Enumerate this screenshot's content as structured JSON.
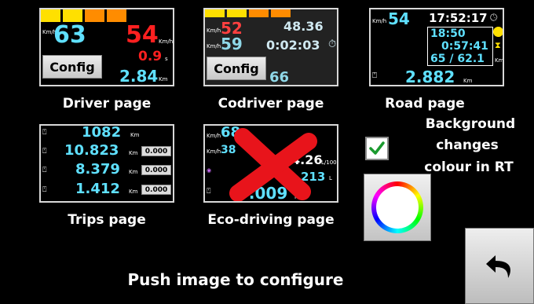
{
  "driver": {
    "caption": "Driver page",
    "speed": "63",
    "speed_unit": "Km/h",
    "limit": "54",
    "limit_unit": "Km/h",
    "small_red": "0.9",
    "small_red_unit": "s",
    "distance": "2.84",
    "distance_unit": "Km",
    "config_label": "Config"
  },
  "codriver": {
    "caption": "Codriver page",
    "speed_red": "52",
    "speed_cyan": "59",
    "dist": "48.36",
    "time": "0:02:03",
    "bottom_partial": "66",
    "unit_kmh": "Km/h",
    "config_label": "Config"
  },
  "road": {
    "caption": "Road page",
    "speed": "54",
    "speed_unit": "Km/h",
    "clock": "17:52:17",
    "time2": "18:50",
    "time3": "0:57:41",
    "dist_pair": "65 / 62.1",
    "dist_pair_unit": "Km",
    "distance": "2.882",
    "distance_unit": "Km"
  },
  "trips": {
    "caption": "Trips page",
    "rows": [
      {
        "value": "1082",
        "unit": "Km",
        "box": ""
      },
      {
        "value": "10.823",
        "unit": "Km",
        "box": "0.000"
      },
      {
        "value": "8.379",
        "unit": "Km",
        "box": "0.000"
      },
      {
        "value": "1.412",
        "unit": "Km",
        "box": "0.000"
      }
    ]
  },
  "eco": {
    "caption": "Eco-driving page",
    "speed1": "68",
    "speed2": "38",
    "unit_kmh": "Km/h",
    "consumption": "4.26",
    "consumption_unit": "L/100",
    "liters": "213",
    "liters_unit": "L",
    "distance": "9.009",
    "distance_unit": "Km"
  },
  "side": {
    "line1": "Background",
    "line2": "changes",
    "line3": "colour in RT",
    "checkbox_checked": true
  },
  "footer": {
    "push_text": "Push image to configure"
  },
  "colors": {
    "cyan": "#5fe0ff",
    "red": "#ff2020",
    "yellow": "#ffe000",
    "orange": "#ff8c00",
    "checkbox_green": "#1a9a2e"
  },
  "icons": {
    "back": "undo-arrow-icon",
    "color_wheel": "color-wheel-icon",
    "check": "check-icon"
  }
}
